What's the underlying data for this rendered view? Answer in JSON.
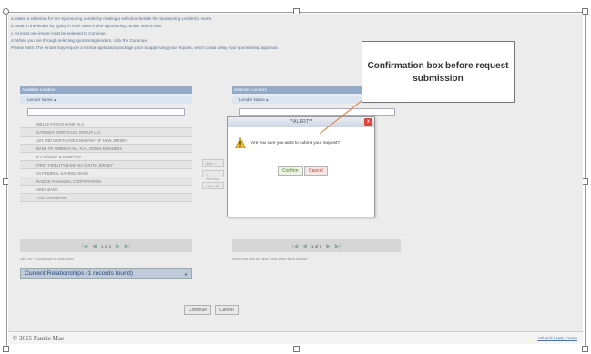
{
  "instructions": [
    "a. Make a selection for the Sponsoring Lender by making a selection beside the Sponsoring Lender(s) name.",
    "b. Search the lender by typing in their name in the Sponsoring Lender search box.",
    "c. At least one lender must be selected to Continue.",
    "d. When you are through selecting sponsoring lenders, click the Continue.",
    "Please Note: The lender may require a formal application package prior to approving your request, which could delay your sponsorship approval."
  ],
  "available": {
    "header": "Available Lenders",
    "column": "Lender Name ▴",
    "lenders": [
      "WELLS FARGO BANK, N.A.",
      "GATEWAY MORTGAGE GROUP LLC",
      "1ST 2ND MORTGAGE COMPANY OF NEW JERSEY",
      "BANK OF AMERICA NA, N.A., DOING BUSINESS",
      "E H CRUMP & COMPANY",
      "FIRST FIDELITY BANK NA SOUTH JERSEY",
      "VA FEDERAL SAVINGS BANK",
      "RADICE FINANCIAL CORPORATION",
      "AREA BANK",
      "THE DANA BANK"
    ],
    "pager": "1 of 1",
    "hint": "Use Ctrl + mouse click to multi-select"
  },
  "selected": {
    "header": "Selected Lenders",
    "column": "Lender Name ▴",
    "pager": "1 of 1",
    "hint": "Select one item at a time, multi-select is not allowed"
  },
  "move_buttons": [
    "Add >",
    "< Remove",
    "Undo All"
  ],
  "current_relationships": "Current Relationships (1 records found)",
  "footer_buttons": {
    "continue": "Continue",
    "cancel": "Cancel"
  },
  "footer": {
    "copyright": "© 2015 Fannie Mae",
    "links": "Job Aids | Help Center"
  },
  "dialog": {
    "title": "**ALERT**",
    "message": "Are you sure you want to submit your request?",
    "confirm": "Confirm",
    "cancel": "Cancel",
    "close": "x"
  },
  "callout": "Confirmation box before request submission",
  "colors": {
    "accent": "#93a9c8",
    "alert_close": "#d9463a",
    "warning": "#f2c318"
  }
}
